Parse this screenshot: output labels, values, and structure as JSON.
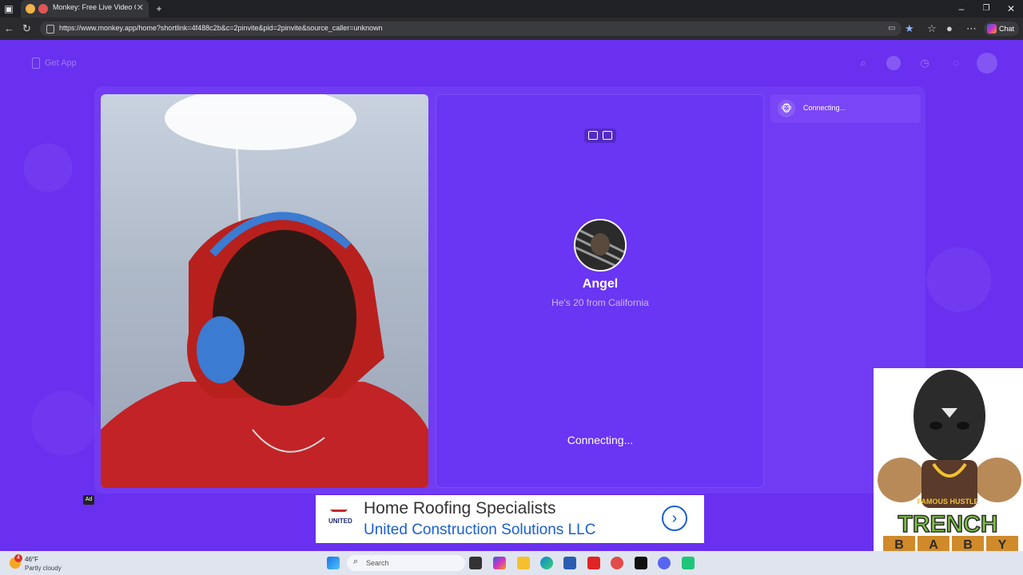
{
  "browser": {
    "tab_title": "Monkey: Free Live Video Ch",
    "url": "https://www.monkey.app/home?shortlink=4f488c2b&c=2pinvite&pid=2pinvite&source_caller=unknown",
    "chat_label": "Chat"
  },
  "header": {
    "get_app": "Get App"
  },
  "partner": {
    "name": "Angel",
    "info": "He's 20 from California",
    "status": "Connecting..."
  },
  "sidebar": {
    "status": "Connecting...",
    "avatar_emoji": "🐵"
  },
  "ad": {
    "tag": "Ad",
    "brand": "UNITED",
    "headline": "Home Roofing Specialists",
    "company": "United Construction Solutions LLC",
    "cta_glyph": "›"
  },
  "taskbar": {
    "weather_badge": "4",
    "temperature": "46°F",
    "weather_desc": "Partly cloudy",
    "search_label": "Search"
  },
  "icons": [
    "search-icon",
    "profile-icon",
    "history-icon",
    "chat-icon",
    "avatar-icon",
    "swap-camera-icon",
    "flip-video-icon"
  ]
}
